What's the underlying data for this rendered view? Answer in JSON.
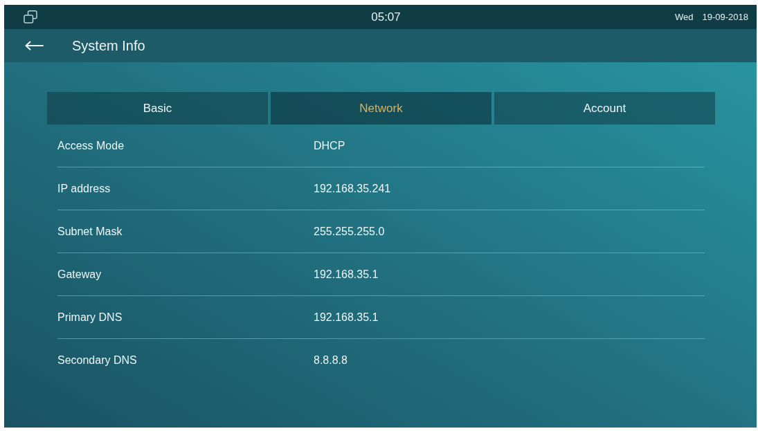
{
  "status_bar": {
    "time": "05:07",
    "day": "Wed",
    "date": "19-09-2018"
  },
  "header": {
    "title": "System Info"
  },
  "tabs": [
    {
      "label": "Basic",
      "selected": false
    },
    {
      "label": "Network",
      "selected": true
    },
    {
      "label": "Account",
      "selected": false
    }
  ],
  "rows": [
    {
      "label": "Access Mode",
      "value": "DHCP"
    },
    {
      "label": "IP address",
      "value": "192.168.35.241"
    },
    {
      "label": "Subnet Mask",
      "value": "255.255.255.0"
    },
    {
      "label": "Gateway",
      "value": "192.168.35.1"
    },
    {
      "label": "Primary DNS",
      "value": "192.168.35.1"
    },
    {
      "label": "Secondary DNS",
      "value": "8.8.8.8"
    }
  ]
}
